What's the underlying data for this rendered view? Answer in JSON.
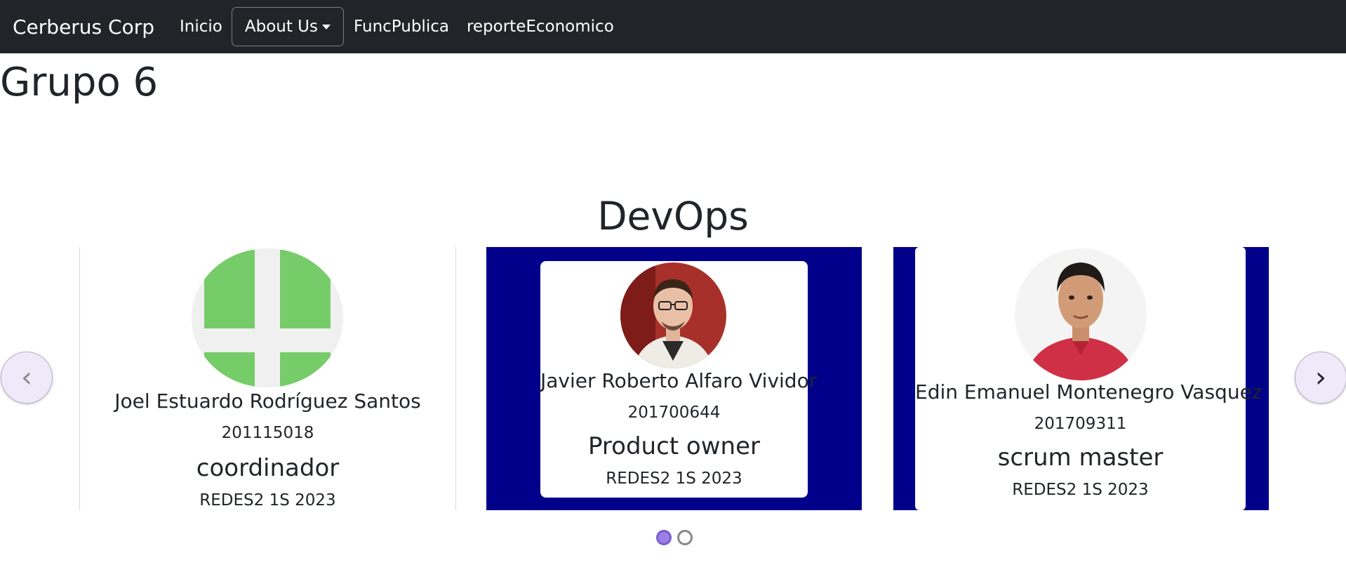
{
  "navbar": {
    "brand": "Cerberus Corp",
    "links": [
      "Inicio",
      "About Us",
      "FuncPublica",
      "reporteEconomico"
    ]
  },
  "page_title": "Grupo 6",
  "section_title": "DevOps",
  "carousel": {
    "prev_glyph": "‹",
    "next_glyph": "›",
    "active_slide": 1,
    "slide_count": 2,
    "colors": {
      "card_background": "#00008b",
      "dot_active": "#9b7fe6"
    },
    "members": [
      {
        "name": "Joel Estuardo Rodríguez Santos",
        "carnet": "201115018",
        "role": "coordinador",
        "course": "REDES2 1S 2023",
        "avatar_icon": "green-identicon"
      },
      {
        "name": "Javier Roberto Alfaro Vividor",
        "carnet": "201700644",
        "role": "Product owner",
        "course": "REDES2 1S 2023",
        "avatar_icon": "person-photo"
      },
      {
        "name": "Edin Emanuel Montenegro Vasquez",
        "carnet": "201709311",
        "role": "scrum master",
        "course": "REDES2 1S 2023",
        "avatar_icon": "person-photo"
      }
    ]
  }
}
